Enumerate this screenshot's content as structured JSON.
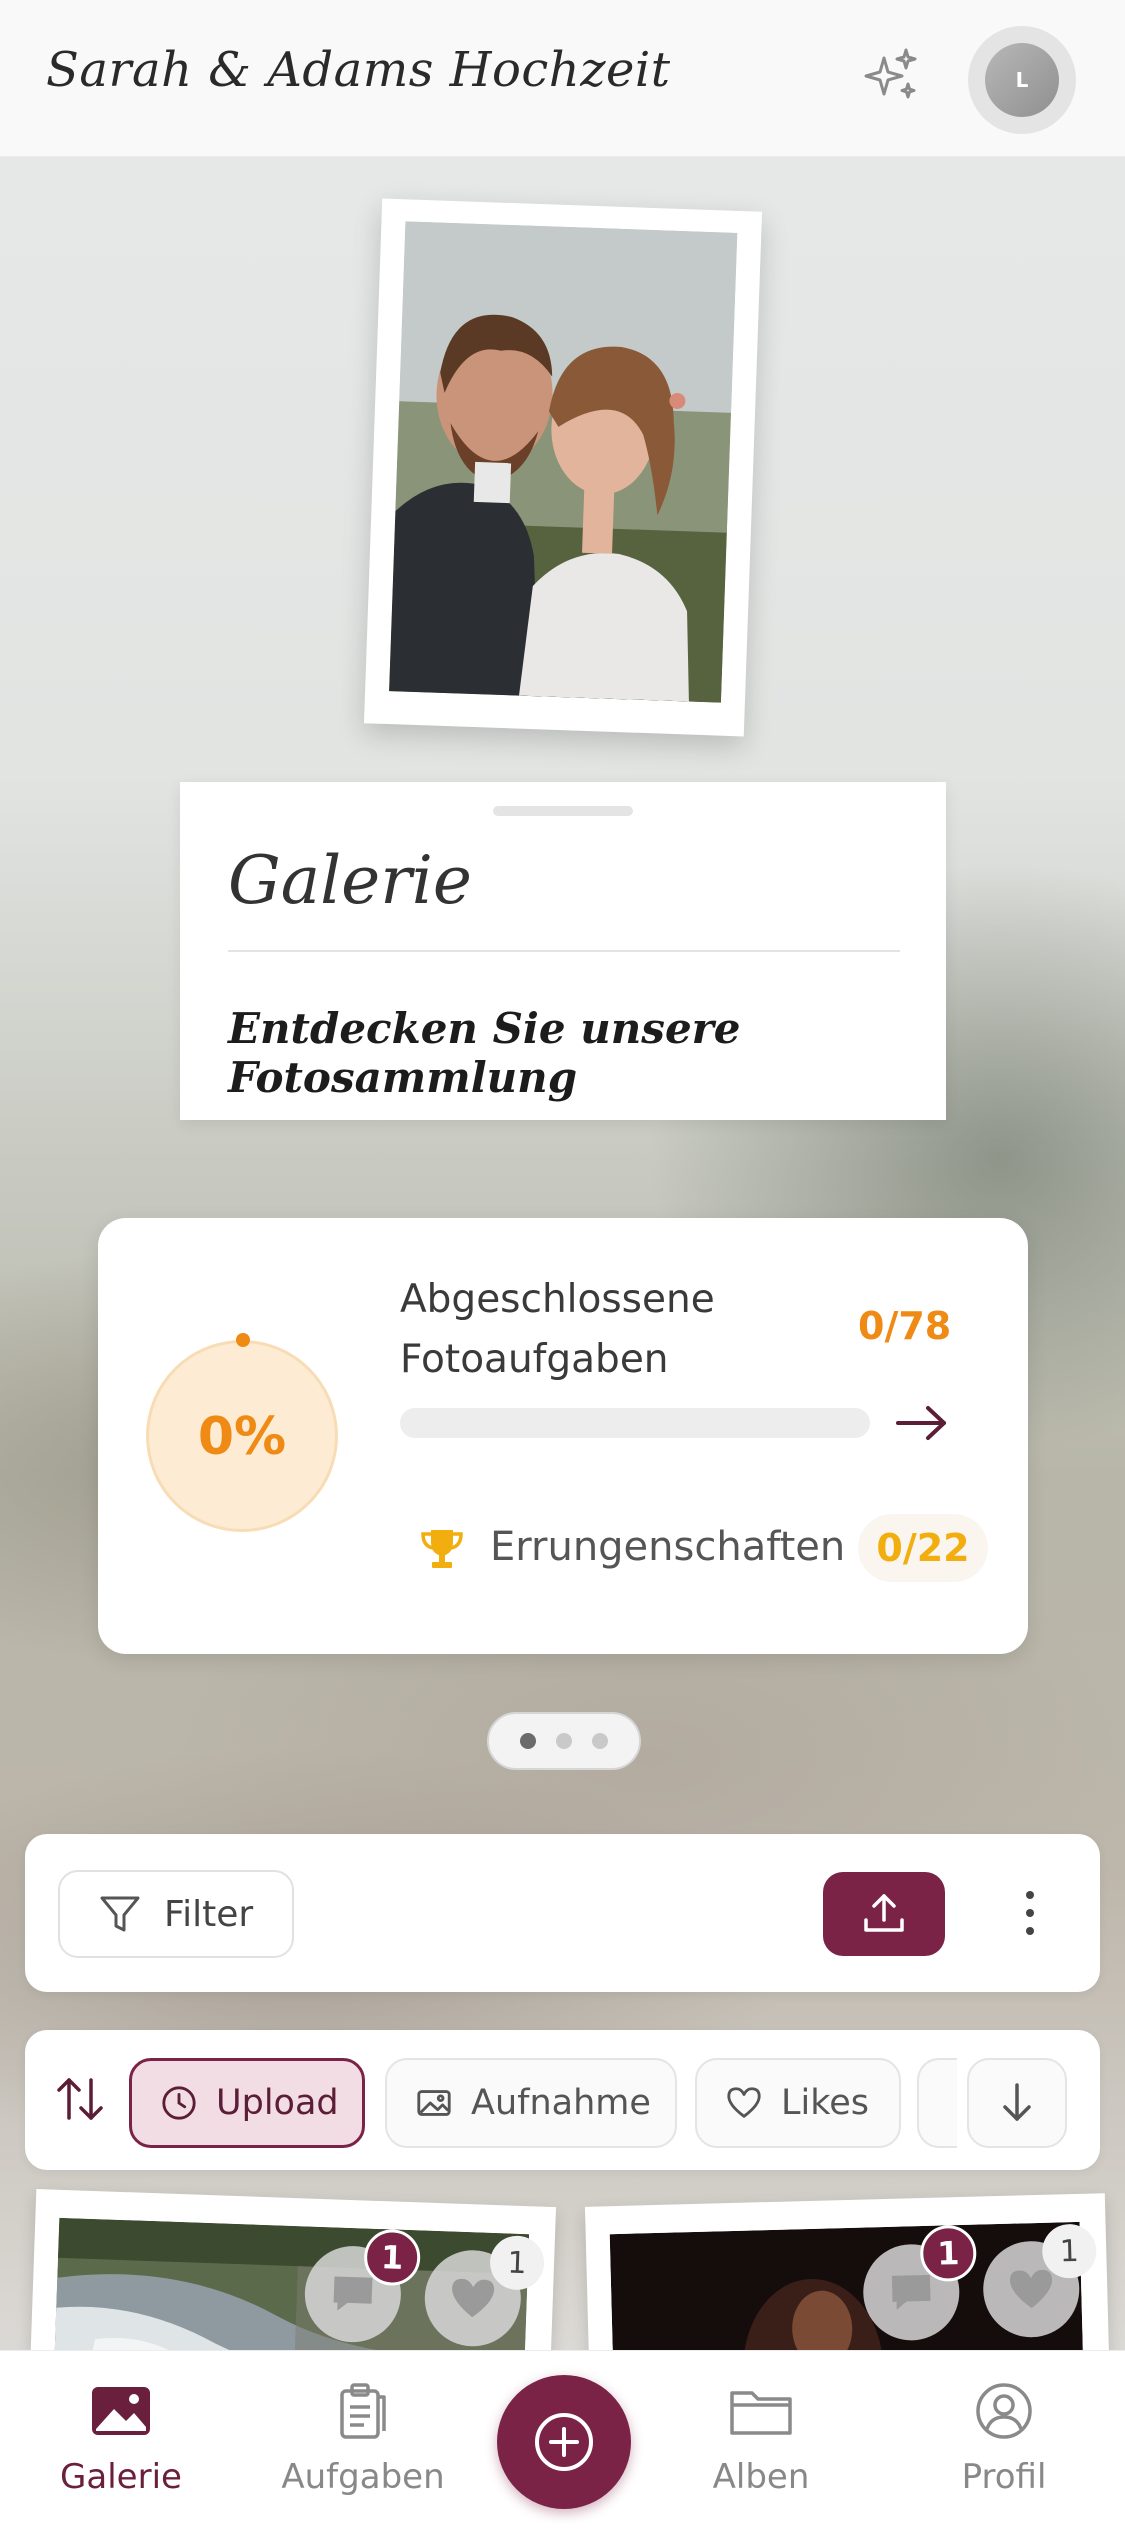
{
  "header": {
    "title": "Sarah & Adams Hochzeit",
    "sparkle_icon": "sparkles-icon",
    "avatar_initial": "L"
  },
  "section": {
    "title": "Galerie",
    "subtitle": "Entdecken Sie unsere Fotosammlung"
  },
  "progress": {
    "percent_label": "0%",
    "percent_value": 0,
    "label": "Abgeschlossene Fotoaufgaben",
    "count": "0/78",
    "achievements_label": "Errungenschaften",
    "achievements_count": "0/22"
  },
  "pager": {
    "pages": 3,
    "active": 0
  },
  "toolbar": {
    "filter_label": "Filter"
  },
  "sort": {
    "chips": [
      {
        "label": "Upload",
        "icon": "clock-icon",
        "active": true
      },
      {
        "label": "Aufnahme",
        "icon": "image-icon",
        "active": false
      },
      {
        "label": "Likes",
        "icon": "heart-icon",
        "active": false
      }
    ]
  },
  "gallery": {
    "tiles": [
      {
        "comments": "1",
        "likes": "1"
      },
      {
        "comments": "1",
        "likes": "1"
      }
    ]
  },
  "nav": {
    "items": [
      {
        "label": "Galerie",
        "active": true
      },
      {
        "label": "Aufgaben",
        "active": false
      },
      {
        "label": "Alben",
        "active": false
      },
      {
        "label": "Profil",
        "active": false
      }
    ]
  },
  "colors": {
    "brand": "#7b2346",
    "accent_orange": "#ef8a14",
    "accent_gold": "#f1ae0e"
  }
}
